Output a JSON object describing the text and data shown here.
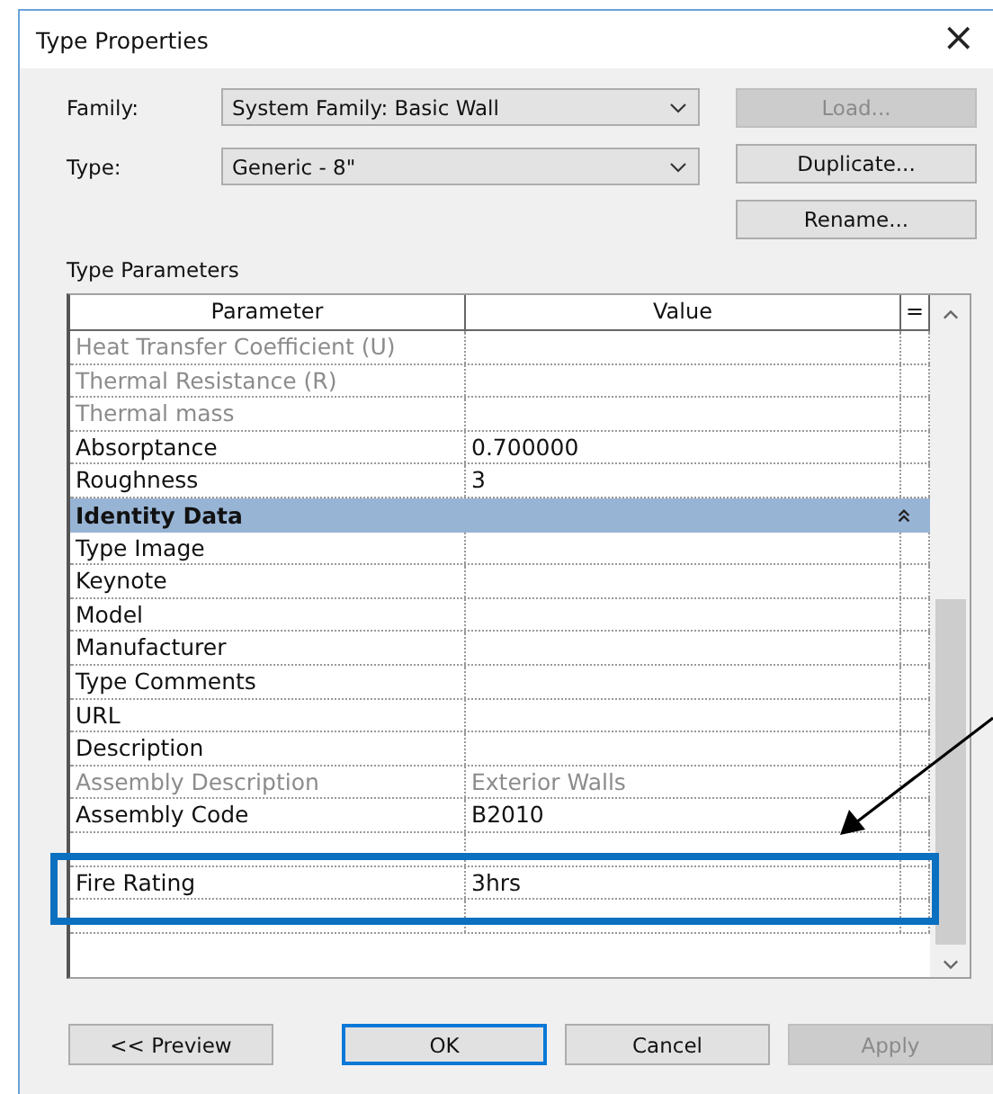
{
  "window": {
    "title": "Type Properties",
    "close": "×"
  },
  "fields": [
    {
      "label": "Family:",
      "value": "System Family: Basic Wall"
    },
    {
      "label": "Type:",
      "value": "Generic - 8\""
    }
  ],
  "side_buttons": [
    {
      "label": "Load...",
      "disabled": true
    },
    {
      "label": "Duplicate...",
      "disabled": false
    },
    {
      "label": "Rename...",
      "disabled": false
    }
  ],
  "section_title": "Type Parameters",
  "table": {
    "columns": [
      "Parameter",
      "Value",
      "="
    ],
    "rows": [
      {
        "kind": "param",
        "name": "Heat Transfer Coefficient (U)",
        "value": "",
        "disabled": true
      },
      {
        "kind": "param",
        "name": "Thermal Resistance (R)",
        "value": "",
        "disabled": true
      },
      {
        "kind": "param",
        "name": "Thermal mass",
        "value": "",
        "disabled": true
      },
      {
        "kind": "param",
        "name": "Absorptance",
        "value": "0.700000",
        "disabled": false
      },
      {
        "kind": "param",
        "name": "Roughness",
        "value": "3",
        "disabled": false
      },
      {
        "kind": "group",
        "name": "Identity Data",
        "expanded": true
      },
      {
        "kind": "param",
        "name": "Type Image",
        "value": "",
        "disabled": false
      },
      {
        "kind": "param",
        "name": "Keynote",
        "value": "",
        "disabled": false
      },
      {
        "kind": "param",
        "name": "Model",
        "value": "",
        "disabled": false
      },
      {
        "kind": "param",
        "name": "Manufacturer",
        "value": "",
        "disabled": false
      },
      {
        "kind": "param",
        "name": "Type Comments",
        "value": "",
        "disabled": false
      },
      {
        "kind": "param",
        "name": "URL",
        "value": "",
        "disabled": false
      },
      {
        "kind": "param",
        "name": "Description",
        "value": "",
        "disabled": false
      },
      {
        "kind": "param",
        "name": "Assembly Description",
        "value": "Exterior Walls",
        "disabled": true
      },
      {
        "kind": "param",
        "name": "Assembly Code",
        "value": "B2010",
        "disabled": false
      },
      {
        "kind": "param"
      },
      {
        "kind": "param",
        "name": "Fire Rating",
        "value": "3hrs",
        "disabled": false
      },
      {
        "kind": "param"
      }
    ]
  },
  "buttons": [
    {
      "label": "<< Preview",
      "default": false,
      "disabled": false
    },
    {
      "label": "OK",
      "default": true,
      "disabled": false
    },
    {
      "label": "Cancel",
      "default": false,
      "disabled": false
    },
    {
      "label": "Apply",
      "default": false,
      "disabled": true
    }
  ]
}
